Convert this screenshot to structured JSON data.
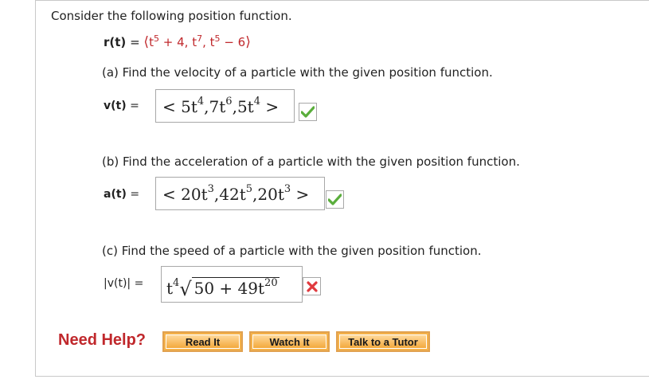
{
  "intro": "Consider the following position function.",
  "position_function": {
    "label": "r(t)",
    "equals": "=",
    "open": "⟨",
    "close": "⟩",
    "c1_base": "t",
    "c1_exp": "5",
    "c1_rest": "+ 4",
    "c2_base": "t",
    "c2_exp": "7",
    "c3_base": "t",
    "c3_exp": "5",
    "c3_rest": "− 6"
  },
  "part_a": {
    "question": "(a) Find the velocity of a particle with the given position function.",
    "label": "v(t)",
    "equals": "=",
    "answer": {
      "lt": "<",
      "t1_coef": "5t",
      "t1_exp": "4",
      "t2_coef": "7t",
      "t2_exp": "6",
      "t3_coef": "5t",
      "t3_exp": "4",
      "gt": ">"
    },
    "status": "correct"
  },
  "part_b": {
    "question": "(b) Find the acceleration of a particle with the given position function.",
    "label": "a(t)",
    "equals": "=",
    "answer": {
      "lt": "<",
      "t1_coef": "20t",
      "t1_exp": "3",
      "t2_coef": "42t",
      "t2_exp": "5",
      "t3_coef": "20t",
      "t3_exp": "3",
      "gt": ">"
    },
    "status": "correct"
  },
  "part_c": {
    "question": "(c) Find the speed of a particle with the given position function.",
    "label": "|v(t)|",
    "equals": "=",
    "answer": {
      "pre_base": "t",
      "pre_exp": "4",
      "radicand_main": "50 + 49t",
      "radicand_exp": "20"
    },
    "status": "incorrect"
  },
  "help": {
    "label": "Need Help?",
    "buttons": [
      "Read It",
      "Watch It",
      "Talk to a Tutor"
    ]
  },
  "colors": {
    "accent_red": "#c0282c",
    "correct_green": "#5aae3c",
    "button_orange": "#f5b24a"
  }
}
